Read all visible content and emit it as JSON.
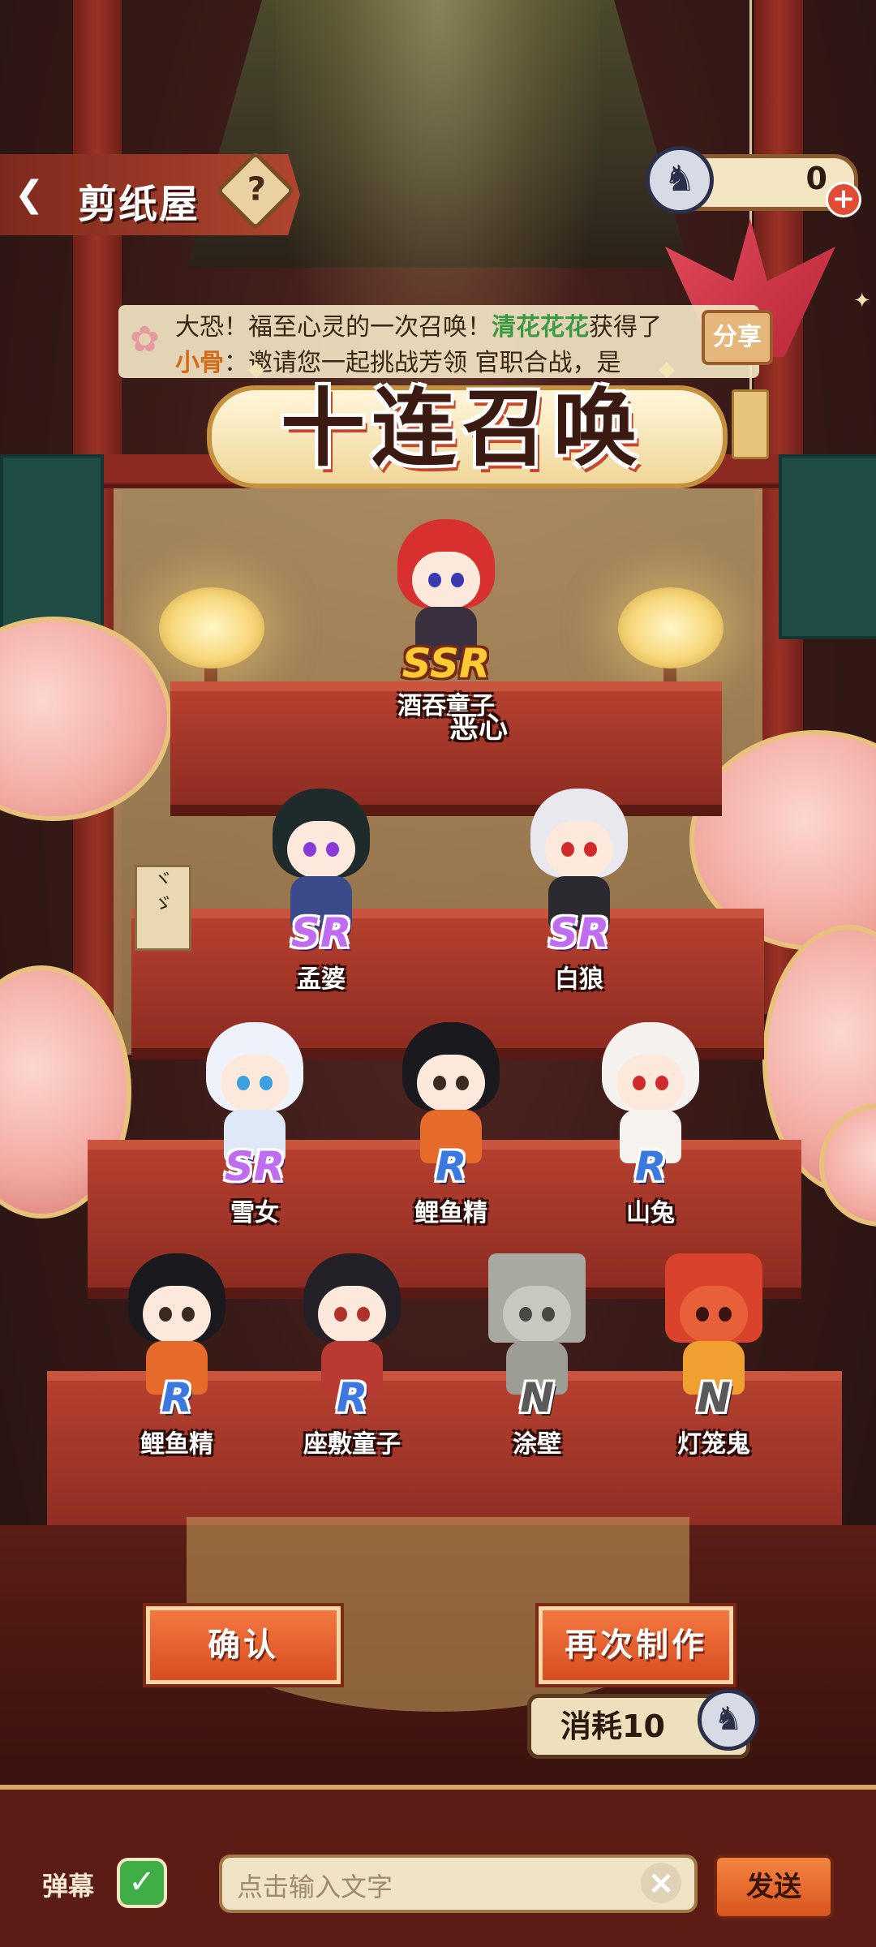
{
  "header": {
    "title": "剪纸屋",
    "back_icon": "back-arrow-icon",
    "help_label": "?",
    "currency_value": "0",
    "currency_icon": "spirit-doll-icon",
    "plus_label": "+"
  },
  "ticker": {
    "line1_start": "大恐！福至心灵的一次召唤！",
    "line1_highlight": "清花花花",
    "line1_end": "获得了",
    "line2_highlight": "小骨",
    "line2_text": "：邀请您一起挑战芳领 官职合战，是",
    "button_label": "分享"
  },
  "main_title": "十连召唤",
  "characters": [
    {
      "rarity": "SSR",
      "name": "酒吞童子",
      "overlay": "恶心"
    },
    {
      "rarity": "SR",
      "name": "孟婆"
    },
    {
      "rarity": "SR",
      "name": "白狼"
    },
    {
      "rarity": "SR",
      "name": "雪女"
    },
    {
      "rarity": "R",
      "name": "鲤鱼精"
    },
    {
      "rarity": "R",
      "name": "山兔"
    },
    {
      "rarity": "R",
      "name": "鲤鱼精"
    },
    {
      "rarity": "R",
      "name": "座敷童子"
    },
    {
      "rarity": "N",
      "name": "涂壁"
    },
    {
      "rarity": "N",
      "name": "灯笼鬼"
    }
  ],
  "actions": {
    "confirm_label": "确认",
    "again_label": "再次制作",
    "cost_label": "消耗10"
  },
  "bottom": {
    "danmu_label": "弹幕",
    "danmu_checked": "✓",
    "input_placeholder": "点击输入文字",
    "clear_label": "×",
    "send_label": "发送"
  },
  "colors": {
    "ssr": "#ffcb35",
    "sr": "#c06cf2",
    "r": "#3b79e0",
    "n": "#5a5a5a",
    "button": "#e4602f"
  }
}
